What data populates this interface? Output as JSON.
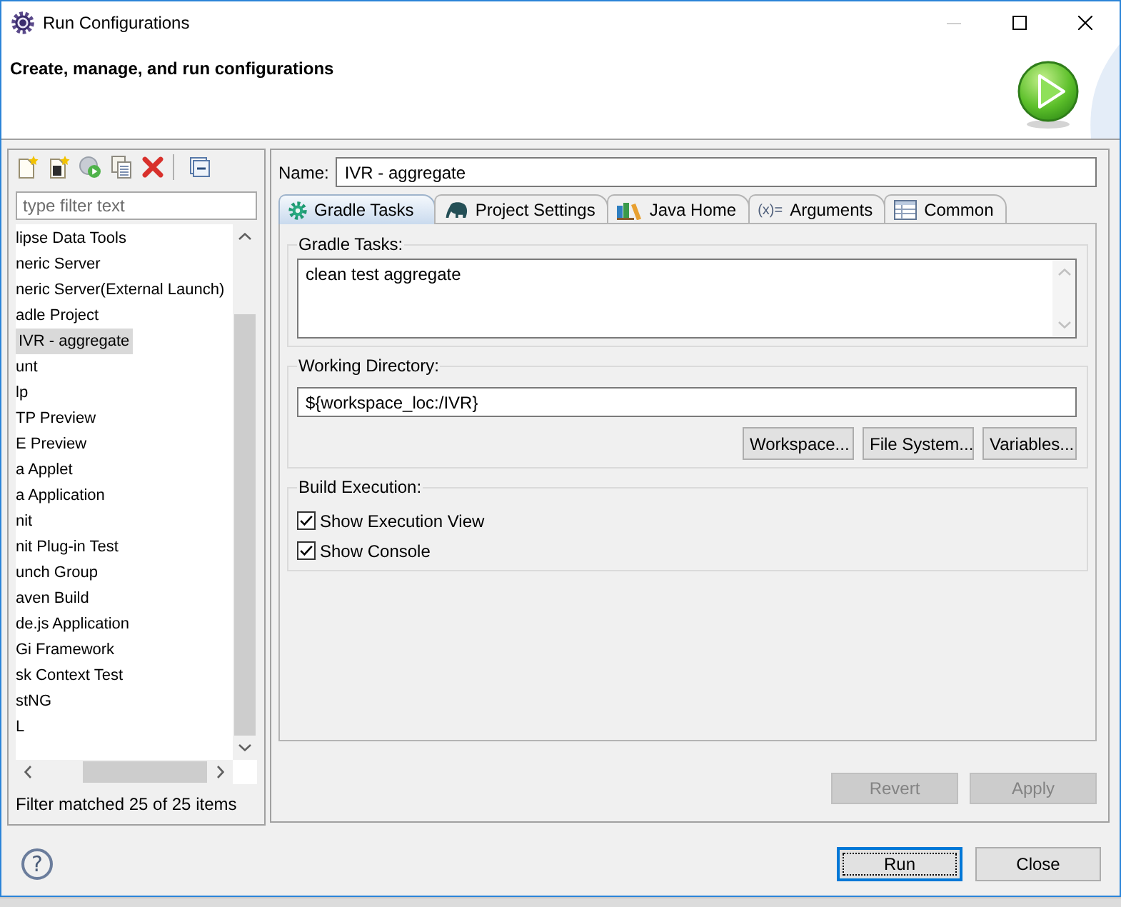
{
  "window": {
    "title": "Run Configurations",
    "minimize_enabled": false
  },
  "header": {
    "title": "Create, manage, and run configurations"
  },
  "filter": {
    "placeholder": "type filter text"
  },
  "tree": {
    "items": [
      {
        "label": "lipse Data Tools",
        "selected": false
      },
      {
        "label": "neric Server",
        "selected": false
      },
      {
        "label": "neric Server(External Launch)",
        "selected": false
      },
      {
        "label": "adle Project",
        "selected": false,
        "children": [
          {
            "label": "IVR - aggregate",
            "selected": true
          }
        ]
      },
      {
        "label": "unt",
        "selected": false
      },
      {
        "label": "lp",
        "selected": false
      },
      {
        "label": "TP Preview",
        "selected": false
      },
      {
        "label": "E Preview",
        "selected": false
      },
      {
        "label": "a Applet",
        "selected": false
      },
      {
        "label": "a Application",
        "selected": false
      },
      {
        "label": "nit",
        "selected": false
      },
      {
        "label": "nit Plug-in Test",
        "selected": false
      },
      {
        "label": "unch Group",
        "selected": false
      },
      {
        "label": "aven Build",
        "selected": false
      },
      {
        "label": "de.js Application",
        "selected": false
      },
      {
        "label": "Gi Framework",
        "selected": false
      },
      {
        "label": "sk Context Test",
        "selected": false
      },
      {
        "label": "stNG",
        "selected": false
      },
      {
        "label": "L",
        "selected": false
      }
    ]
  },
  "filter_status": "Filter matched 25 of 25 items",
  "name_field": {
    "label": "Name:",
    "value": "IVR - aggregate"
  },
  "tabs": [
    {
      "label": "Gradle Tasks",
      "selected": true
    },
    {
      "label": "Project Settings",
      "selected": false
    },
    {
      "label": "Java Home",
      "selected": false
    },
    {
      "label": "Arguments",
      "icon_text": "(x)=",
      "selected": false
    },
    {
      "label": "Common",
      "selected": false
    }
  ],
  "gradle_tasks": {
    "label": "Gradle Tasks:",
    "value": "clean test aggregate"
  },
  "working_directory": {
    "label": "Working Directory:",
    "value": "${workspace_loc:/IVR}",
    "buttons": [
      "Workspace...",
      "File System...",
      "Variables..."
    ]
  },
  "build_execution": {
    "label": "Build Execution:",
    "options": [
      {
        "label": "Show Execution View",
        "checked": true
      },
      {
        "label": "Show Console",
        "checked": true
      }
    ]
  },
  "config_buttons": [
    {
      "label": "Revert",
      "disabled": true
    },
    {
      "label": "Apply",
      "disabled": true
    }
  ],
  "help": {
    "symbol": "?"
  },
  "dialog_buttons": [
    {
      "label": "Run",
      "default": true
    },
    {
      "label": "Close",
      "default": false
    }
  ]
}
